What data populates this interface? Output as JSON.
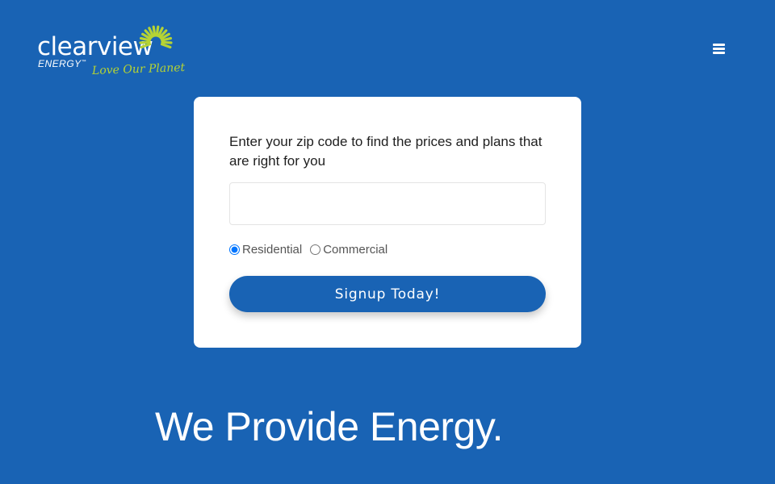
{
  "brand": {
    "name": "clearview",
    "sub": "ENERGY",
    "trademark": "™",
    "tagline": "Love Our Planet",
    "colors": {
      "primary": "#1963b4",
      "accent": "#b5d334",
      "card": "#ffffff"
    }
  },
  "header": {
    "menu_icon": "hamburger-menu-icon"
  },
  "form": {
    "prompt": "Enter your zip code to find the prices and plans that are right for you",
    "zip": {
      "value": "",
      "placeholder": ""
    },
    "options": [
      {
        "label": "Residential",
        "selected": true
      },
      {
        "label": "Commercial",
        "selected": false
      }
    ],
    "submit_label": "Signup Today!"
  },
  "hero": {
    "title": "We Provide Energy."
  }
}
